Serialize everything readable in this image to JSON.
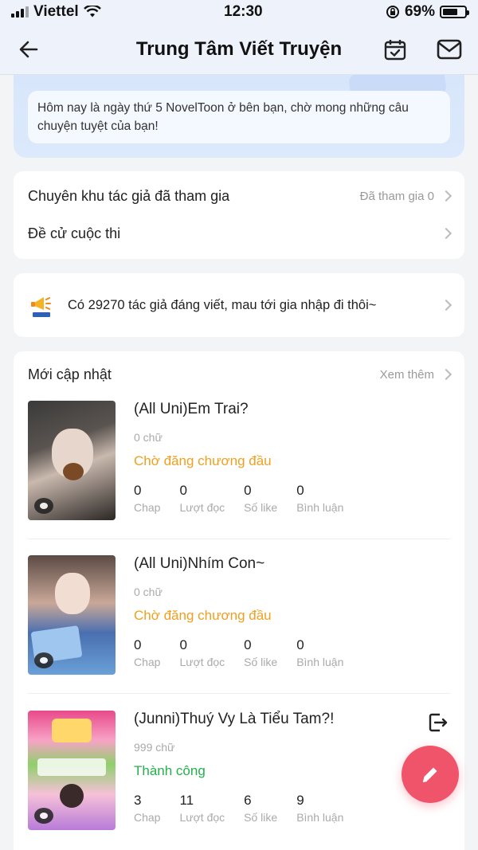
{
  "status_bar": {
    "carrier": "Viettel",
    "time": "12:30",
    "battery": "69%",
    "battery_level": 0.69
  },
  "header": {
    "title": "Trung Tâm Viết Truyện",
    "back_icon": "arrow-left-icon",
    "calendar_icon": "calendar-check-icon",
    "mail_icon": "mail-icon"
  },
  "banner": {
    "message": "Hôm nay là ngày thứ 5 NovelToon ở bên bạn, chờ mong những câu chuyện tuyệt của bạn!"
  },
  "menu": {
    "author_zone": {
      "label": "Chuyên khu tác giả đã tham gia",
      "meta": "Đã tham gia 0"
    },
    "contest": {
      "label": "Đề cử cuộc thi"
    }
  },
  "promo": {
    "text": "Có 29270 tác giả đáng viết, mau tới gia nhập đi thôi~",
    "icon": "megaphone-icon"
  },
  "recent": {
    "title": "Mới cập nhật",
    "more": "Xem thêm",
    "stat_labels": {
      "chap": "Chap",
      "reads": "Lượt đọc",
      "likes": "Số like",
      "comments": "Bình luận"
    },
    "stories": [
      {
        "title": "(All Uni)Em Trai?",
        "words": "0 chữ",
        "status": "Chờ đăng chương đầu",
        "status_color": "#f0a020",
        "chap": "0",
        "reads": "0",
        "likes": "0",
        "comments": "0"
      },
      {
        "title": "(All Uni)Nhím Con~",
        "words": "0 chữ",
        "status": "Chờ đăng chương đầu",
        "status_color": "#f0a020",
        "chap": "0",
        "reads": "0",
        "likes": "0",
        "comments": "0"
      },
      {
        "title": "(Junni)Thuý Vy Là Tiểu Tam?!",
        "words": "999 chữ",
        "status": "Thành công",
        "status_color": "#22b14c",
        "chap": "3",
        "reads": "11",
        "likes": "6",
        "comments": "9"
      }
    ]
  },
  "fab": {
    "icon": "pencil-icon",
    "color": "#f0546a"
  }
}
